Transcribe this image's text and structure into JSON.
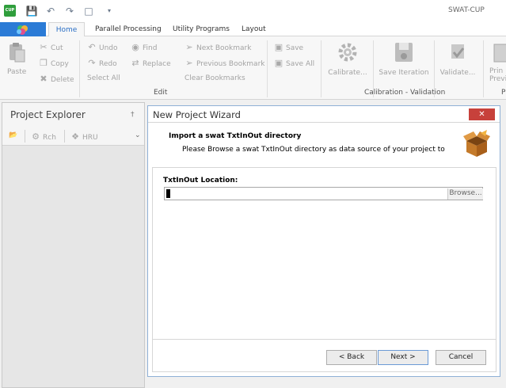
{
  "app": {
    "title": "SWAT-CUP",
    "icon_text": "CUP"
  },
  "quick_access": [
    "save-icon",
    "undo-icon",
    "redo-icon",
    "preview-icon",
    "customize-icon"
  ],
  "ribbon": {
    "tabs": [
      {
        "label": "Home",
        "active": true
      },
      {
        "label": "Parallel Processing"
      },
      {
        "label": "Utility Programs"
      },
      {
        "label": "Layout"
      }
    ],
    "clipboard": {
      "paste": "Paste",
      "cut": "Cut",
      "copy": "Copy",
      "delete": "Delete"
    },
    "edit": {
      "undo": "Undo",
      "redo": "Redo",
      "select_all": "Select All",
      "find": "Find",
      "replace": "Replace",
      "next_bookmark": "Next Bookmark",
      "previous_bookmark": "Previous Bookmark",
      "clear_bookmarks": "Clear Bookmarks",
      "save": "Save",
      "save_all": "Save All",
      "group_label": "Edit"
    },
    "calibration": {
      "calibrate": "Calibrate...",
      "save_iteration": "Save Iteration",
      "validate": "Validate...",
      "group_label": "Calibration - Validation"
    },
    "print": {
      "line1": "Prin",
      "line2": "Previ",
      "group_label_partial": "P"
    }
  },
  "explorer": {
    "title": "Project Explorer",
    "pin": "†",
    "tools": {
      "rch": "Rch",
      "hru": "HRU"
    }
  },
  "wizard": {
    "title": "New Project Wizard",
    "close": "✕",
    "heading": "Import a swat TxtInOut directory",
    "description": "Please Browse a swat TxtInOut directory as data source of your project to",
    "location_label": "TxtInOut Location:",
    "location_value": "",
    "browse": "Browse...",
    "back": "< Back",
    "next": "Next >",
    "cancel": "Cancel"
  },
  "colors": {
    "accent": "#2b7bd6",
    "close": "#c7413b",
    "app_icon": "#2f9e3c"
  }
}
